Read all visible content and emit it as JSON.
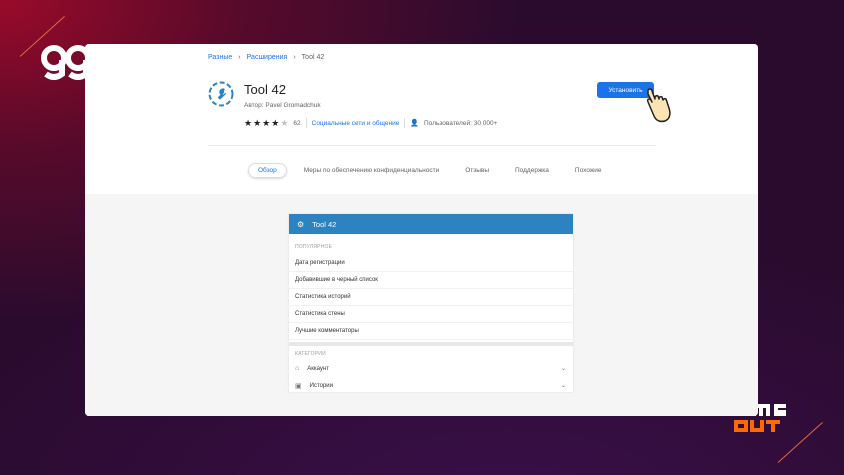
{
  "breadcrumb": {
    "items": [
      "Разные",
      "Расширения",
      "Tool 42"
    ]
  },
  "extension": {
    "title": "Tool 42",
    "author": "Автор: Pavel Gromadchuk",
    "rating": 4,
    "reviews_count": "62",
    "category": "Социальные сети и общение",
    "users": "Пользователей: 30 000+"
  },
  "install_label": "Установить",
  "tabs": [
    {
      "label": "Обзор",
      "active": true
    },
    {
      "label": "Меры по обеспечению конфиденциальности",
      "active": false
    },
    {
      "label": "Отзывы",
      "active": false
    },
    {
      "label": "Поддержка",
      "active": false
    },
    {
      "label": "Похожие",
      "active": false
    }
  ],
  "popup": {
    "title": "Tool 42",
    "popular_label": "ПОПУЛЯРНОЕ",
    "popular_items": [
      "Дата регистрации",
      "Добавившие в черный список",
      "Статистика историй",
      "Статистика стены",
      "Лучшие комментаторы"
    ],
    "categories_label": "КАТЕГОРИИ",
    "categories": [
      {
        "label": "Аккаунт",
        "icon": "home-icon"
      },
      {
        "label": "Истории",
        "icon": "stories-icon"
      }
    ]
  },
  "colors": {
    "accent": "#1a73e8",
    "popup_header": "#2d82c0",
    "background": "#2a0b2e"
  }
}
